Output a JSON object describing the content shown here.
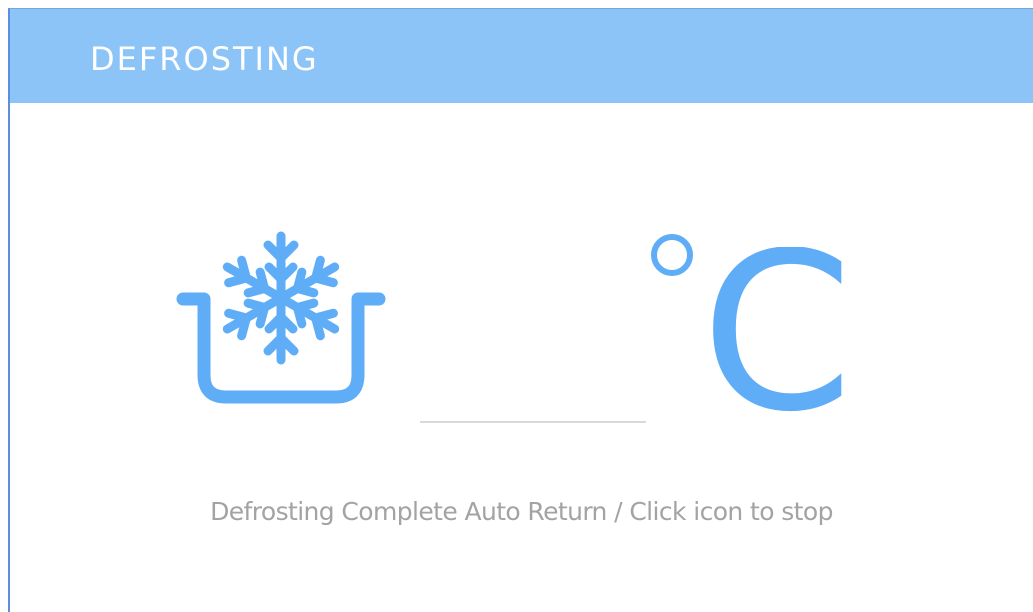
{
  "header": {
    "title": "DEFROSTING"
  },
  "temperature": {
    "unit_letter": "C",
    "value": ""
  },
  "icons": {
    "defrost": "snowflake-pot-icon",
    "degree": "degree-icon"
  },
  "status_message": "Defrosting Complete Auto Return / Click icon to stop",
  "colors": {
    "header_bg": "#8cc4f7",
    "accent": "#5fadf6",
    "status_text": "#a3a3a3"
  }
}
